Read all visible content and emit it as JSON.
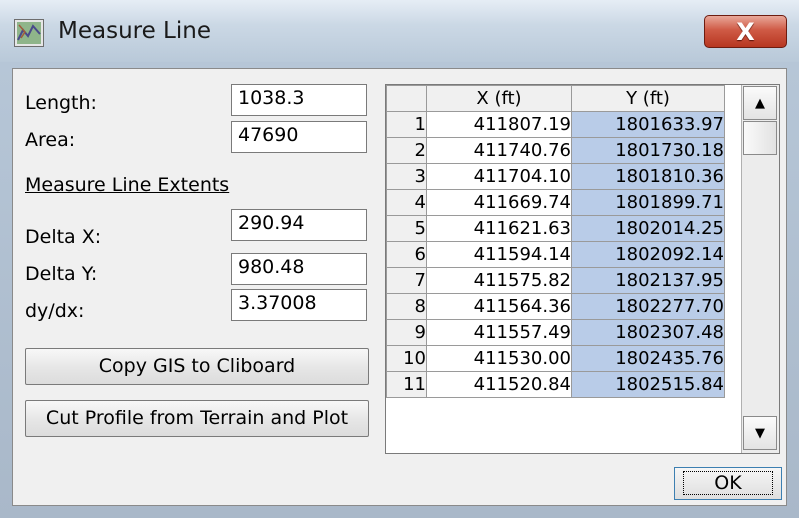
{
  "window": {
    "title": "Measure Line",
    "close_glyph": "X"
  },
  "left": {
    "length_label": "Length:",
    "length_value": "1038.3",
    "area_label": "Area:",
    "area_value": "47690",
    "extents_label": "Measure Line Extents",
    "delta_x_label": "Delta X:",
    "delta_x_value": "290.94",
    "delta_y_label": "Delta Y:",
    "delta_y_value": "980.48",
    "dydx_label": "dy/dx:",
    "dydx_value": "3.37008",
    "copy_button": "Copy GIS to Cliboard",
    "cut_button": "Cut Profile from Terrain and Plot"
  },
  "table": {
    "columns": [
      "",
      "X (ft)",
      "Y (ft)"
    ],
    "rows": [
      {
        "n": "1",
        "x": "411807.19",
        "y": "1801633.97"
      },
      {
        "n": "2",
        "x": "411740.76",
        "y": "1801730.18"
      },
      {
        "n": "3",
        "x": "411704.10",
        "y": "1801810.36"
      },
      {
        "n": "4",
        "x": "411669.74",
        "y": "1801899.71"
      },
      {
        "n": "5",
        "x": "411621.63",
        "y": "1802014.25"
      },
      {
        "n": "6",
        "x": "411594.14",
        "y": "1802092.14"
      },
      {
        "n": "7",
        "x": "411575.82",
        "y": "1802137.95"
      },
      {
        "n": "8",
        "x": "411564.36",
        "y": "1802277.70"
      },
      {
        "n": "9",
        "x": "411557.49",
        "y": "1802307.48"
      },
      {
        "n": "10",
        "x": "411530.00",
        "y": "1802435.76"
      },
      {
        "n": "11",
        "x": "411520.84",
        "y": "1802515.84"
      }
    ]
  },
  "scroll": {
    "up_glyph": "▲",
    "down_glyph": "▼"
  },
  "ok_label": "OK"
}
